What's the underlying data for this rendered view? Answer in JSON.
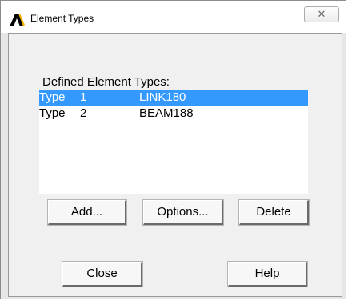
{
  "window": {
    "title": "Element Types",
    "close_glyph": "✕",
    "app_icon": "ansys-logo-icon"
  },
  "list": {
    "caption": "Defined Element Types:",
    "items": [
      {
        "type_label": "Type",
        "number": "1",
        "name": "LINK180",
        "selected": true
      },
      {
        "type_label": "Type",
        "number": "2",
        "name": "BEAM188",
        "selected": false
      }
    ]
  },
  "buttons": {
    "add": "Add...",
    "options": "Options...",
    "delete": "Delete",
    "close": "Close",
    "help": "Help"
  },
  "colors": {
    "selection": "#3399ff",
    "logo_fill": "#000000",
    "logo_accent": "#f4b400"
  }
}
